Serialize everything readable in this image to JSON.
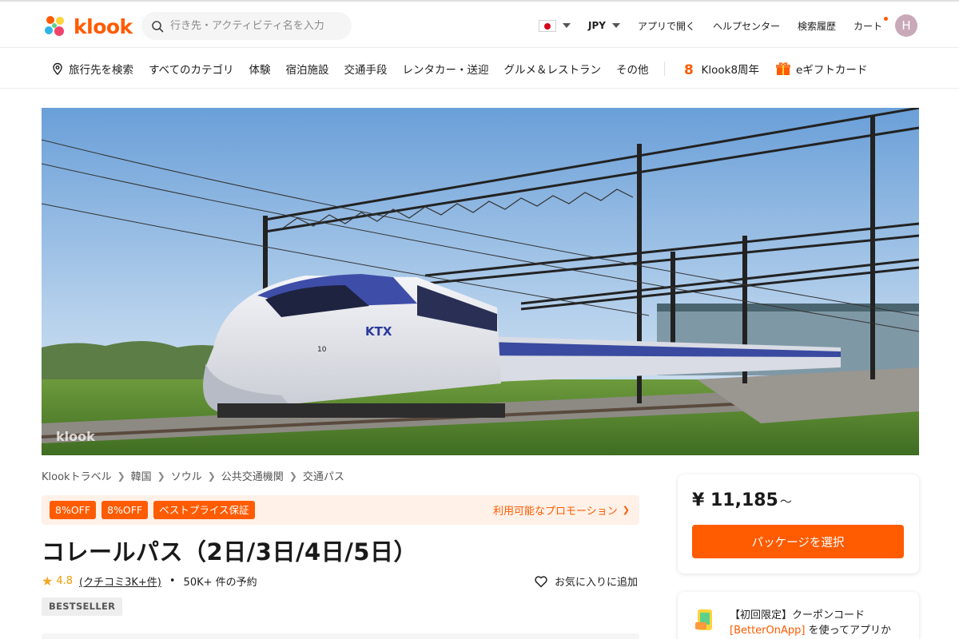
{
  "header": {
    "brand": "klook",
    "search_placeholder": "行き先・アクティビティ名を入力",
    "currency": "JPY",
    "open_app": "アプリで開く",
    "help_center": "ヘルプセンター",
    "search_history": "検索履歴",
    "cart": "カート",
    "avatar_initial": "H",
    "accent_color": "#ff5b00"
  },
  "nav": {
    "destination": "旅行先を検索",
    "items": [
      "すべてのカテゴリ",
      "体験",
      "宿泊施設",
      "交通手段",
      "レンタカー・送迎",
      "グルメ＆レストラン",
      "その他"
    ],
    "anniversary": "Klook8周年",
    "gift_card": "eギフトカード"
  },
  "hero": {
    "watermark": "klook",
    "train_logo": "KTX",
    "car_number": "10"
  },
  "breadcrumb": [
    "Klookトラベル",
    "韓国",
    "ソウル",
    "公共交通機関",
    "交通パス"
  ],
  "promo": {
    "badges": [
      "8%OFF",
      "8%OFF",
      "ベストプライス保証"
    ],
    "link": "利用可能なプロモーション"
  },
  "product": {
    "title": "コレールパス（2日/3日/4日/5日）",
    "rating": "4.8",
    "reviews": "(クチコミ3K+件)",
    "bookings": "50K+ 件の予約",
    "wishlist": "お気に入りに追加",
    "tag": "BESTSELLER"
  },
  "booking": {
    "price": "¥ 11,185",
    "price_suffix": "～",
    "select_button": "パッケージを選択"
  },
  "coupon": {
    "line1": "【初回限定】クーポンコード",
    "code": "[BetterOnApp]",
    "line2": " を使ってアプリか"
  }
}
